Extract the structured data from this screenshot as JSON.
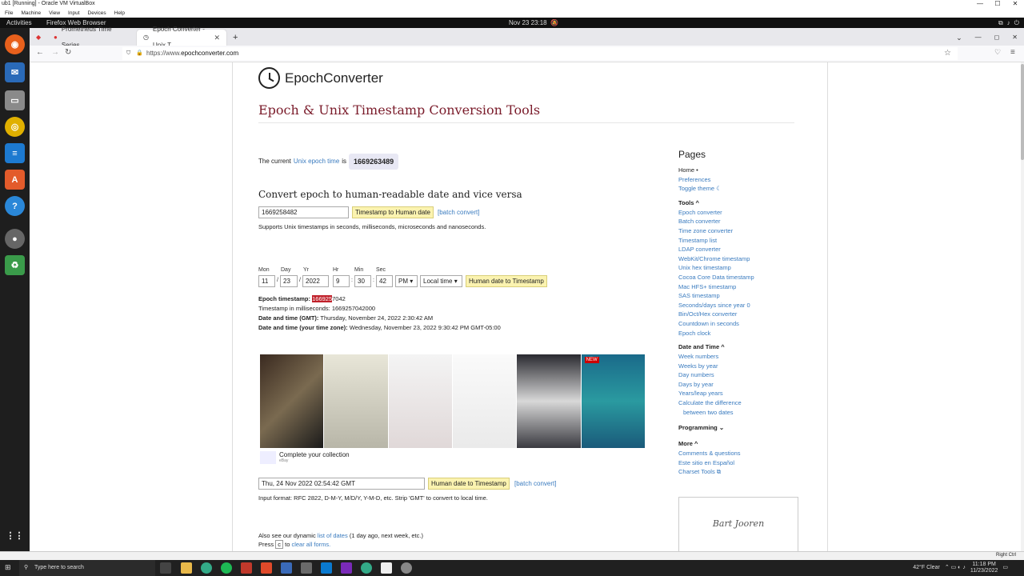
{
  "vbox": {
    "title": "ub1 [Running] - Oracle VM VirtualBox",
    "menu": [
      "File",
      "Machine",
      "View",
      "Input",
      "Devices",
      "Help"
    ]
  },
  "gnome": {
    "activities": "Activities",
    "app": "Firefox Web Browser",
    "clock": "Nov 23  23:18"
  },
  "tabs": [
    {
      "label": "Prometheus Time Series"
    },
    {
      "label": "Epoch Converter - Unix T"
    }
  ],
  "url": {
    "prefix": "https://www.",
    "domain": "epochconverter.com"
  },
  "site": {
    "logo": "EpochConverter",
    "heading": "Epoch & Unix Timestamp Conversion Tools"
  },
  "current": {
    "prefix": "The current",
    "link": "Unix epoch time",
    "is": "is",
    "value": "1669263489"
  },
  "convert": {
    "heading": "Convert epoch to human-readable date and vice versa",
    "input": "1669258482",
    "button": "Timestamp to Human date",
    "batch": "[batch convert]",
    "note": "Supports Unix timestamps in seconds, milliseconds, microseconds and nanoseconds."
  },
  "human": {
    "labels": {
      "mon": "Mon",
      "day": "Day",
      "yr": "Yr",
      "hr": "Hr",
      "min": "Min",
      "sec": "Sec"
    },
    "values": {
      "mon": "11",
      "day": "23",
      "yr": "2022",
      "hr": "9",
      "min": "30",
      "sec": "42"
    },
    "ampm": "PM",
    "zone": "Local time",
    "button": "Human date to Timestamp"
  },
  "result": {
    "epoch_label": "Epoch timestamp:",
    "epoch_selected": "166925",
    "epoch_rest": "7042",
    "ms": "Timestamp in milliseconds: 1669257042000",
    "gmt_label": "Date and time (GMT):",
    "gmt": " Thursday, November 24, 2022 2:30:42 AM",
    "tz_label": "Date and time (your time zone):",
    "tz": " Wednesday, November 23, 2022 9:30:42 PM GMT-05:00"
  },
  "ad": {
    "text": "Complete your collection",
    "sub": "eBay",
    "badge": "NEW"
  },
  "rfc": {
    "input": "Thu, 24 Nov 2022 02:54:42 GMT",
    "button": "Human date to Timestamp",
    "batch": "[batch convert]",
    "note": "Input format: RFC 2822, D-M-Y, M/D/Y, Y-M-D, etc. Strip 'GMT' to convert to local time."
  },
  "footer": {
    "also": "Also see our dynamic",
    "list_link": "list of dates",
    "also_rest": "(1 day ago, next week, etc.)",
    "press": "Press",
    "key": "c",
    "to": "to",
    "clear_link": "clear all forms."
  },
  "sidebar": {
    "title": "Pages",
    "pages": [
      "Home •",
      "Preferences",
      "Toggle theme ☾"
    ],
    "tools_title": "Tools ^",
    "tools": [
      "Epoch converter",
      "Batch converter",
      "Time zone converter",
      "Timestamp list",
      "LDAP converter",
      "WebKit/Chrome timestamp",
      "Unix hex timestamp",
      "Cocoa Core Data timestamp",
      "Mac HFS+ timestamp",
      "SAS timestamp",
      "Seconds/days since year 0",
      "Bin/Oct/Hex converter",
      "Countdown in seconds",
      "Epoch clock"
    ],
    "dt_title": "Date and Time ^",
    "dt": [
      "Week numbers",
      "Weeks by year",
      "Day numbers",
      "Days by year",
      "Years/leap years",
      "Calculate the difference"
    ],
    "dt_indent": "between two dates",
    "prog_title": "Programming ⌄",
    "more_title": "More ^",
    "more": [
      "Comments & questions",
      "Este sitio en Español",
      "Charset Tools ⧉"
    ]
  },
  "signature": "Bart Jooren",
  "taskbar": {
    "search": "Type here to search",
    "weather": "42°F  Clear",
    "time": "11:18 PM",
    "date": "11/23/2022"
  },
  "statusbar": {
    "right": "Right Ctrl"
  }
}
